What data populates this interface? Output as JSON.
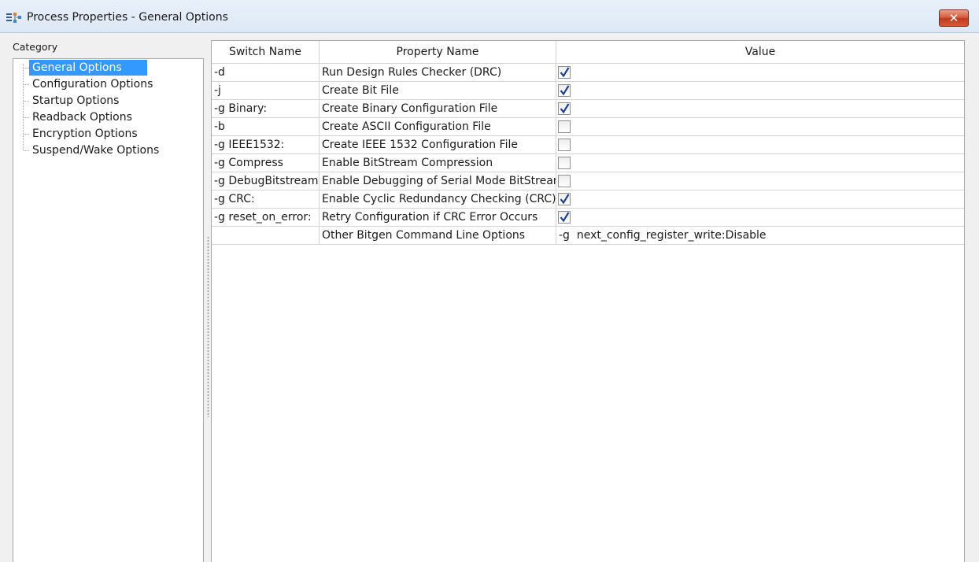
{
  "window": {
    "title": "Process Properties - General Options"
  },
  "category": {
    "label": "Category",
    "items": [
      {
        "label": "General Options",
        "selected": true
      },
      {
        "label": "Configuration Options",
        "selected": false
      },
      {
        "label": "Startup Options",
        "selected": false
      },
      {
        "label": "Readback Options",
        "selected": false
      },
      {
        "label": "Encryption Options",
        "selected": false
      },
      {
        "label": "Suspend/Wake Options",
        "selected": false
      }
    ]
  },
  "table": {
    "headers": {
      "switch": "Switch Name",
      "property": "Property Name",
      "value": "Value"
    },
    "rows": [
      {
        "switch": "-d",
        "property": "Run Design Rules Checker (DRC)",
        "type": "checkbox",
        "checked": true
      },
      {
        "switch": "-j",
        "property": "Create Bit File",
        "type": "checkbox",
        "checked": true
      },
      {
        "switch": "-g Binary:",
        "property": "Create Binary Configuration File",
        "type": "checkbox",
        "checked": true
      },
      {
        "switch": "-b",
        "property": "Create ASCII Configuration File",
        "type": "checkbox",
        "checked": false
      },
      {
        "switch": "-g IEEE1532:",
        "property": "Create IEEE 1532 Configuration File",
        "type": "checkbox",
        "checked": false
      },
      {
        "switch": "-g Compress",
        "property": "Enable BitStream Compression",
        "type": "checkbox",
        "checked": false
      },
      {
        "switch": "-g DebugBitstream:",
        "property": "Enable Debugging of Serial Mode BitStream",
        "type": "checkbox",
        "checked": false
      },
      {
        "switch": "-g CRC:",
        "property": "Enable Cyclic Redundancy Checking (CRC)",
        "type": "checkbox",
        "checked": true
      },
      {
        "switch": "-g reset_on_error:",
        "property": "Retry Configuration if CRC Error Occurs",
        "type": "checkbox",
        "checked": true
      },
      {
        "switch": "",
        "property": "Other Bitgen Command Line Options",
        "type": "text",
        "value": "-g  next_config_register_write:Disable"
      }
    ]
  },
  "icons": {
    "title": "process-properties-icon",
    "close": "close-icon",
    "check": "checkmark-icon"
  },
  "colors": {
    "selection": "#3399ff",
    "check": "#1c3f94",
    "close": "#c7442a"
  }
}
